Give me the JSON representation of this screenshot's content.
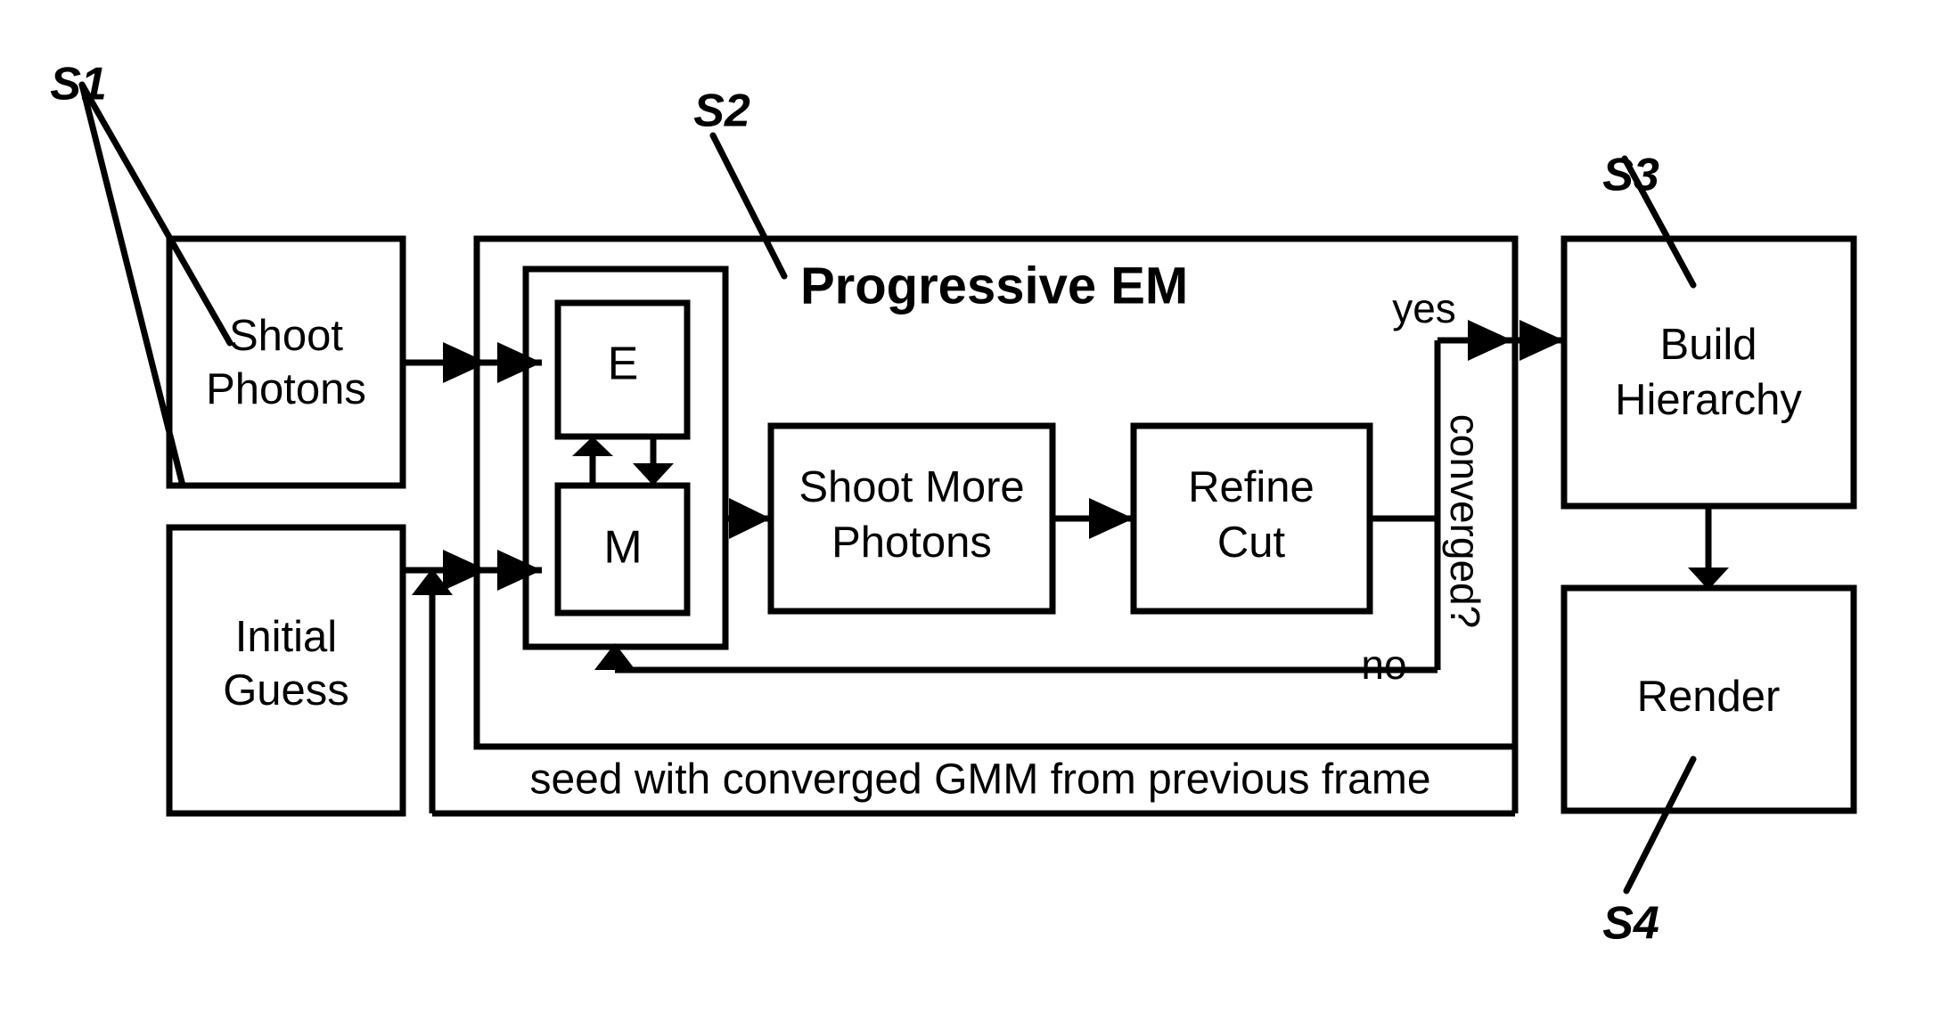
{
  "diagram": {
    "title": "Progressive EM",
    "step_labels": [
      {
        "id": "S1",
        "text": "S1"
      },
      {
        "id": "S2",
        "text": "S2"
      },
      {
        "id": "S3",
        "text": "S3"
      },
      {
        "id": "S4",
        "text": "S4"
      }
    ],
    "boxes": [
      {
        "id": "shoot-photons",
        "line1": "Shoot",
        "line2": "Photons"
      },
      {
        "id": "initial-guess",
        "line1": "Initial",
        "line2": "Guess"
      },
      {
        "id": "e-step",
        "line1": "E",
        "line2": ""
      },
      {
        "id": "m-step",
        "line1": "M",
        "line2": ""
      },
      {
        "id": "shoot-more-photons",
        "line1": "Shoot More",
        "line2": "Photons"
      },
      {
        "id": "refine-cut",
        "line1": "Refine",
        "line2": "Cut"
      },
      {
        "id": "build-hierarchy",
        "line1": "Build",
        "line2": "Hierarchy"
      },
      {
        "id": "render",
        "line1": "Render",
        "line2": ""
      }
    ],
    "edge_labels": {
      "yes": "yes",
      "no": "no",
      "converged": "converged?",
      "seed": "seed with converged GMM from previous frame"
    },
    "colors": {
      "stroke": "#000000",
      "fill": "#ffffff",
      "background": "#ffffff"
    }
  }
}
